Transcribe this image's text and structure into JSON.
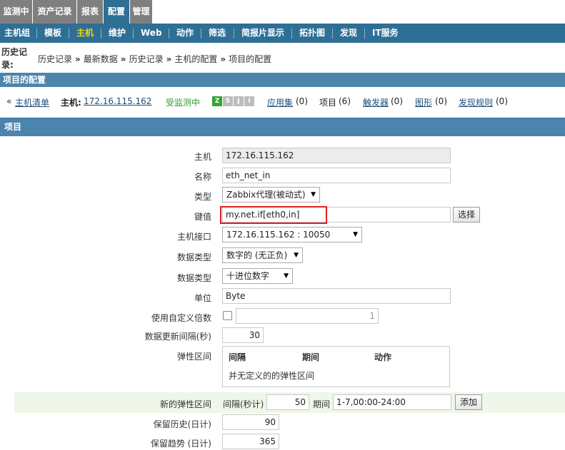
{
  "topnav": {
    "tabs": [
      {
        "label": "监测中",
        "active": false
      },
      {
        "label": "资产记录",
        "active": false
      },
      {
        "label": "报表",
        "active": false
      },
      {
        "label": "配置",
        "active": true
      },
      {
        "label": "管理",
        "active": false
      }
    ]
  },
  "subnav": {
    "items": [
      {
        "label": "主机组",
        "active": false
      },
      {
        "label": "模板",
        "active": false
      },
      {
        "label": "主机",
        "active": true
      },
      {
        "label": "维护",
        "active": false
      },
      {
        "label": "Web",
        "active": false
      },
      {
        "label": "动作",
        "active": false
      },
      {
        "label": "筛选",
        "active": false
      },
      {
        "label": "简报片显示",
        "active": false
      },
      {
        "label": "拓扑图",
        "active": false
      },
      {
        "label": "发现",
        "active": false
      },
      {
        "label": "IT服务",
        "active": false
      }
    ]
  },
  "history": {
    "label": "历史记录:",
    "trail": [
      "历史记录",
      "最新数据",
      "历史记录",
      "主机的配置",
      "项目的配置"
    ],
    "separator": "»"
  },
  "page_title": "项目的配置",
  "hostbar": {
    "back_arrow": "«",
    "host_list": "主机清单",
    "host_label": "主机:",
    "host_ip": "172.16.115.162",
    "status": "受监测中",
    "availability": [
      {
        "letter": "Z",
        "on": true,
        "icon": "zabbix-agent-icon"
      },
      {
        "letter": "S",
        "on": false,
        "icon": "snmp-icon"
      },
      {
        "letter": "J",
        "on": false,
        "icon": "jmx-icon"
      },
      {
        "letter": "I",
        "on": false,
        "icon": "ipmi-icon"
      }
    ],
    "apps_label": "应用集",
    "apps_count": "(0)",
    "items_label": "项目",
    "items_count": "(6)",
    "triggers_label": "触发器",
    "triggers_count": "(0)",
    "graphs_label": "图形",
    "graphs_count": "(0)",
    "discovery_label": "发现规则",
    "discovery_count": "(0)"
  },
  "section_title": "项目",
  "form": {
    "host_label": "主机",
    "host_value": "172.16.115.162",
    "name_label": "名称",
    "name_value": "eth_net_in",
    "type_label": "类型",
    "type_value": "Zabbix代理(被动式)",
    "key_label": "键值",
    "key_value": "my.net.if[eth0,in]",
    "key_select_button": "选择",
    "interface_label": "主机接口",
    "interface_value": "172.16.115.162 : 10050",
    "data_type_label": "数据类型",
    "data_type_value": "数字的 (无正负)",
    "data_format_label": "数据类型",
    "data_format_value": "十进位数字",
    "units_label": "单位",
    "units_value": "Byte",
    "multiplier_label": "使用自定义倍数",
    "multiplier_checked": false,
    "multiplier_value": "1",
    "interval_label": "数据更新间隔(秒)",
    "interval_value": "30",
    "flex_label": "弹性区间",
    "flex_headers": [
      "间隔",
      "期间",
      "动作"
    ],
    "flex_empty": "并无定义的的弹性区间",
    "new_flex_label": "新的弹性区间",
    "new_flex_interval_label": "间隔(秒计)",
    "new_flex_interval_value": "50",
    "new_flex_period_label": "期间",
    "new_flex_period_value": "1-7,00:00-24:00",
    "new_flex_add_button": "添加",
    "history_label": "保留历史(日计)",
    "history_value": "90",
    "trends_label": "保留趋势 (日计)",
    "trends_value": "365"
  },
  "colors": {
    "nav_active": "#2e6f96",
    "nav_tab": "#7f7f7f",
    "subnav_active": "#ffd200",
    "section": "#4b84ac",
    "highlight": "#e02020",
    "status_green": "#2f9a2f"
  }
}
